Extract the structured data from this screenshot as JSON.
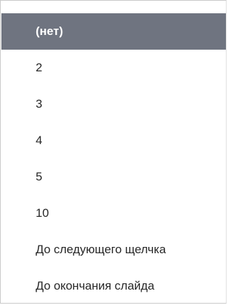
{
  "menu": {
    "items": [
      {
        "label": "(нет)",
        "selected": true
      },
      {
        "label": "2",
        "selected": false
      },
      {
        "label": "3",
        "selected": false
      },
      {
        "label": "4",
        "selected": false
      },
      {
        "label": "5",
        "selected": false
      },
      {
        "label": "10",
        "selected": false
      },
      {
        "label": "До следующего щелчка",
        "selected": false
      },
      {
        "label": "До окончания слайда",
        "selected": false
      }
    ]
  },
  "colors": {
    "selected_background": "#6f7480",
    "selected_text": "#ffffff",
    "text": "#262626",
    "border": "#c8c8c8"
  }
}
